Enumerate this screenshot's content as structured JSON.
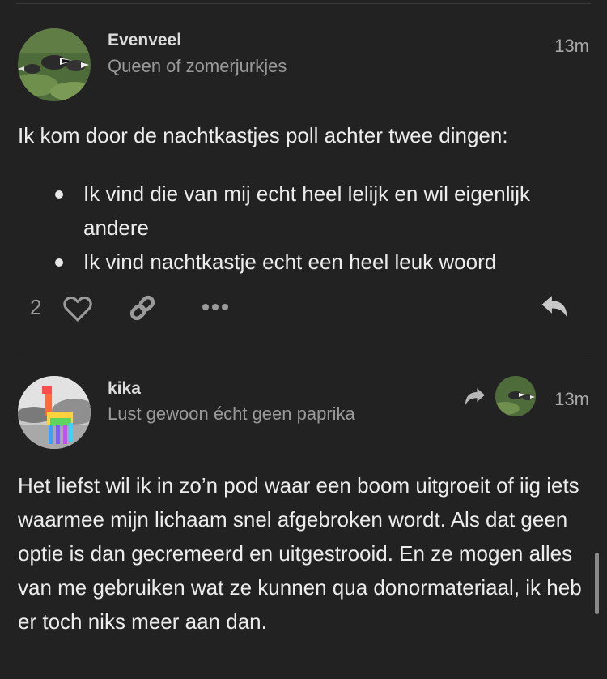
{
  "posts": [
    {
      "username": "Evenveel",
      "user_title": "Queen of zomerjurkjes",
      "time": "13m",
      "text": "Ik kom door de nachtkastjes poll achter twee dingen:",
      "bullets": [
        "Ik vind die van mij echt heel lelijk en wil eigenlijk andere",
        "Ik vind nachtkastje echt een heel leuk woord"
      ],
      "like_count": "2",
      "avatar_icon": "badgers-photo",
      "actions": [
        "heart-icon",
        "link-icon",
        "more-icon",
        "reply-icon"
      ]
    },
    {
      "username": "kika",
      "user_title": "Lust gewoon écht geen paprika",
      "time": "13m",
      "text": "Het liefst wil ik in zo’n pod waar een boom uitgroeit of iig iets waarmee mijn lichaam snel afgebroken wordt. Als dat geen optie is dan gecremeerd en uitgestrooid. En ze mogen alles van me gebruiken wat ze kunnen qua donormateriaal, ik heb er toch niks meer aan dan.",
      "avatar_icon": "rainbow-llama-photo",
      "reply_to_icon": "badgers-photo"
    }
  ],
  "colors": {
    "background": "#222222",
    "text": "#ececec",
    "muted": "#9a9a9a",
    "separator": "#3a3a3a"
  }
}
